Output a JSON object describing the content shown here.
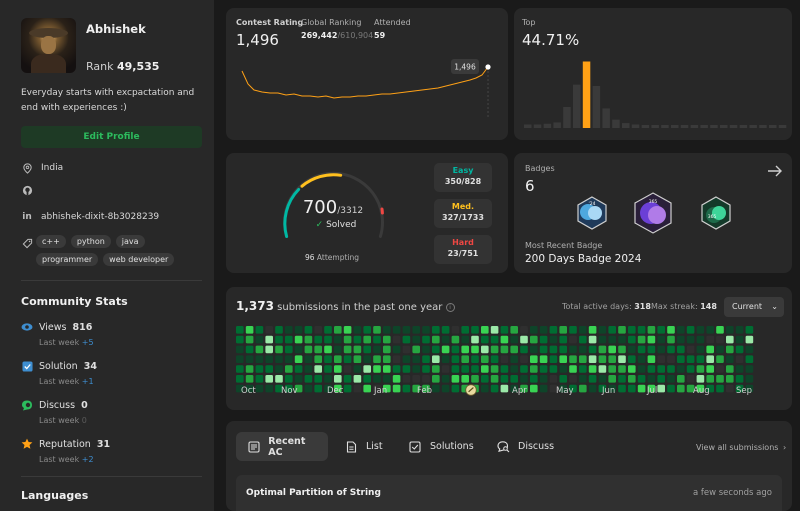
{
  "profile": {
    "name": "Abhishek",
    "rank_label": "Rank",
    "rank_value": "49,535",
    "bio": "Everyday starts with excpactation and end with experiences :)",
    "edit_label": "Edit Profile",
    "location": "India",
    "linkedin": "abhishek-dixit-8b3028239",
    "skills": [
      "c++",
      "python",
      "java",
      "programmer",
      "web developer"
    ]
  },
  "community": {
    "title": "Community Stats",
    "stats": [
      {
        "label": "Views",
        "value": "816",
        "sub": "Last week",
        "delta": "+5",
        "color": "#3e8ed0"
      },
      {
        "label": "Solution",
        "value": "34",
        "sub": "Last week",
        "delta": "+1",
        "color": "#3e8ed0"
      },
      {
        "label": "Discuss",
        "value": "0",
        "sub": "Last week",
        "delta": "0",
        "color": "#2cbb5d"
      },
      {
        "label": "Reputation",
        "value": "31",
        "sub": "Last week",
        "delta": "+2",
        "color": "#ffa116"
      }
    ],
    "languages_title": "Languages"
  },
  "contest": {
    "rating_label": "Contest Rating",
    "rating_value": "1,496",
    "global_label": "Global Ranking",
    "global_value": "269,442",
    "global_total": "/610,904",
    "attended_label": "Attended",
    "attended_value": "59",
    "tooltip": "1,496"
  },
  "top": {
    "label": "Top",
    "value": "44.71%",
    "bars": [
      0.05,
      0.05,
      0.06,
      0.08,
      0.3,
      0.62,
      0.95,
      0.6,
      0.28,
      0.12,
      0.07,
      0.05,
      0.04,
      0.04,
      0.03,
      0.03,
      0.03,
      0.03,
      0.03,
      0.03,
      0.03,
      0.03,
      0.03,
      0.03,
      0.03,
      0.03,
      0.03
    ],
    "highlight_index": 6
  },
  "solved": {
    "solved": "700",
    "total": "/3312",
    "solved_label": "Solved",
    "attempting_count": "96",
    "attempting_label": "Attempting",
    "easy": {
      "name": "Easy",
      "value": "350/828",
      "color": "#00b8a3"
    },
    "medium": {
      "name": "Med.",
      "value": "327/1733",
      "color": "#ffc01e"
    },
    "hard": {
      "name": "Hard",
      "value": "23/751",
      "color": "#ef4743"
    }
  },
  "badges": {
    "label": "Badges",
    "count": "6",
    "recent_label": "Most Recent Badge",
    "recent_name": "200 Days Badge 2024",
    "icons": [
      "'24",
      "365",
      "365"
    ]
  },
  "heatmap": {
    "count": "1,373",
    "suffix": "submissions in the past one year",
    "active_label": "Total active days:",
    "active_value": "318",
    "streak_label": "Max streak:",
    "streak_value": "148",
    "select": "Current",
    "months": [
      "Oct",
      "Nov",
      "Dec",
      "Jan",
      "Feb",
      "",
      "Apr",
      "May",
      "Jun",
      "Jul",
      "Aug",
      "Sep"
    ]
  },
  "tabs": {
    "items": [
      "Recent AC",
      "List",
      "Solutions",
      "Discuss"
    ],
    "view_all": "View all submissions",
    "first_title": "Optimal Partition of String",
    "first_time": "a few seconds ago"
  }
}
